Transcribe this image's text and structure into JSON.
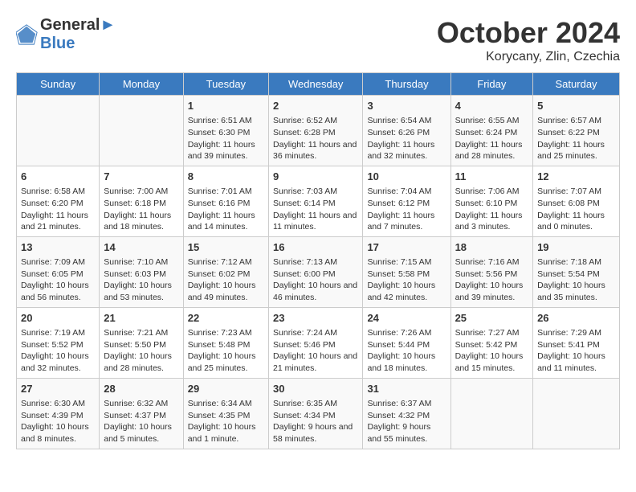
{
  "header": {
    "logo_line1": "General",
    "logo_line2": "Blue",
    "month_title": "October 2024",
    "location": "Korycany, Zlin, Czechia"
  },
  "days_of_week": [
    "Sunday",
    "Monday",
    "Tuesday",
    "Wednesday",
    "Thursday",
    "Friday",
    "Saturday"
  ],
  "weeks": [
    [
      {
        "day": "",
        "content": ""
      },
      {
        "day": "",
        "content": ""
      },
      {
        "day": "1",
        "content": "Sunrise: 6:51 AM\nSunset: 6:30 PM\nDaylight: 11 hours and 39 minutes."
      },
      {
        "day": "2",
        "content": "Sunrise: 6:52 AM\nSunset: 6:28 PM\nDaylight: 11 hours and 36 minutes."
      },
      {
        "day": "3",
        "content": "Sunrise: 6:54 AM\nSunset: 6:26 PM\nDaylight: 11 hours and 32 minutes."
      },
      {
        "day": "4",
        "content": "Sunrise: 6:55 AM\nSunset: 6:24 PM\nDaylight: 11 hours and 28 minutes."
      },
      {
        "day": "5",
        "content": "Sunrise: 6:57 AM\nSunset: 6:22 PM\nDaylight: 11 hours and 25 minutes."
      }
    ],
    [
      {
        "day": "6",
        "content": "Sunrise: 6:58 AM\nSunset: 6:20 PM\nDaylight: 11 hours and 21 minutes."
      },
      {
        "day": "7",
        "content": "Sunrise: 7:00 AM\nSunset: 6:18 PM\nDaylight: 11 hours and 18 minutes."
      },
      {
        "day": "8",
        "content": "Sunrise: 7:01 AM\nSunset: 6:16 PM\nDaylight: 11 hours and 14 minutes."
      },
      {
        "day": "9",
        "content": "Sunrise: 7:03 AM\nSunset: 6:14 PM\nDaylight: 11 hours and 11 minutes."
      },
      {
        "day": "10",
        "content": "Sunrise: 7:04 AM\nSunset: 6:12 PM\nDaylight: 11 hours and 7 minutes."
      },
      {
        "day": "11",
        "content": "Sunrise: 7:06 AM\nSunset: 6:10 PM\nDaylight: 11 hours and 3 minutes."
      },
      {
        "day": "12",
        "content": "Sunrise: 7:07 AM\nSunset: 6:08 PM\nDaylight: 11 hours and 0 minutes."
      }
    ],
    [
      {
        "day": "13",
        "content": "Sunrise: 7:09 AM\nSunset: 6:05 PM\nDaylight: 10 hours and 56 minutes."
      },
      {
        "day": "14",
        "content": "Sunrise: 7:10 AM\nSunset: 6:03 PM\nDaylight: 10 hours and 53 minutes."
      },
      {
        "day": "15",
        "content": "Sunrise: 7:12 AM\nSunset: 6:02 PM\nDaylight: 10 hours and 49 minutes."
      },
      {
        "day": "16",
        "content": "Sunrise: 7:13 AM\nSunset: 6:00 PM\nDaylight: 10 hours and 46 minutes."
      },
      {
        "day": "17",
        "content": "Sunrise: 7:15 AM\nSunset: 5:58 PM\nDaylight: 10 hours and 42 minutes."
      },
      {
        "day": "18",
        "content": "Sunrise: 7:16 AM\nSunset: 5:56 PM\nDaylight: 10 hours and 39 minutes."
      },
      {
        "day": "19",
        "content": "Sunrise: 7:18 AM\nSunset: 5:54 PM\nDaylight: 10 hours and 35 minutes."
      }
    ],
    [
      {
        "day": "20",
        "content": "Sunrise: 7:19 AM\nSunset: 5:52 PM\nDaylight: 10 hours and 32 minutes."
      },
      {
        "day": "21",
        "content": "Sunrise: 7:21 AM\nSunset: 5:50 PM\nDaylight: 10 hours and 28 minutes."
      },
      {
        "day": "22",
        "content": "Sunrise: 7:23 AM\nSunset: 5:48 PM\nDaylight: 10 hours and 25 minutes."
      },
      {
        "day": "23",
        "content": "Sunrise: 7:24 AM\nSunset: 5:46 PM\nDaylight: 10 hours and 21 minutes."
      },
      {
        "day": "24",
        "content": "Sunrise: 7:26 AM\nSunset: 5:44 PM\nDaylight: 10 hours and 18 minutes."
      },
      {
        "day": "25",
        "content": "Sunrise: 7:27 AM\nSunset: 5:42 PM\nDaylight: 10 hours and 15 minutes."
      },
      {
        "day": "26",
        "content": "Sunrise: 7:29 AM\nSunset: 5:41 PM\nDaylight: 10 hours and 11 minutes."
      }
    ],
    [
      {
        "day": "27",
        "content": "Sunrise: 6:30 AM\nSunset: 4:39 PM\nDaylight: 10 hours and 8 minutes."
      },
      {
        "day": "28",
        "content": "Sunrise: 6:32 AM\nSunset: 4:37 PM\nDaylight: 10 hours and 5 minutes."
      },
      {
        "day": "29",
        "content": "Sunrise: 6:34 AM\nSunset: 4:35 PM\nDaylight: 10 hours and 1 minute."
      },
      {
        "day": "30",
        "content": "Sunrise: 6:35 AM\nSunset: 4:34 PM\nDaylight: 9 hours and 58 minutes."
      },
      {
        "day": "31",
        "content": "Sunrise: 6:37 AM\nSunset: 4:32 PM\nDaylight: 9 hours and 55 minutes."
      },
      {
        "day": "",
        "content": ""
      },
      {
        "day": "",
        "content": ""
      }
    ]
  ]
}
